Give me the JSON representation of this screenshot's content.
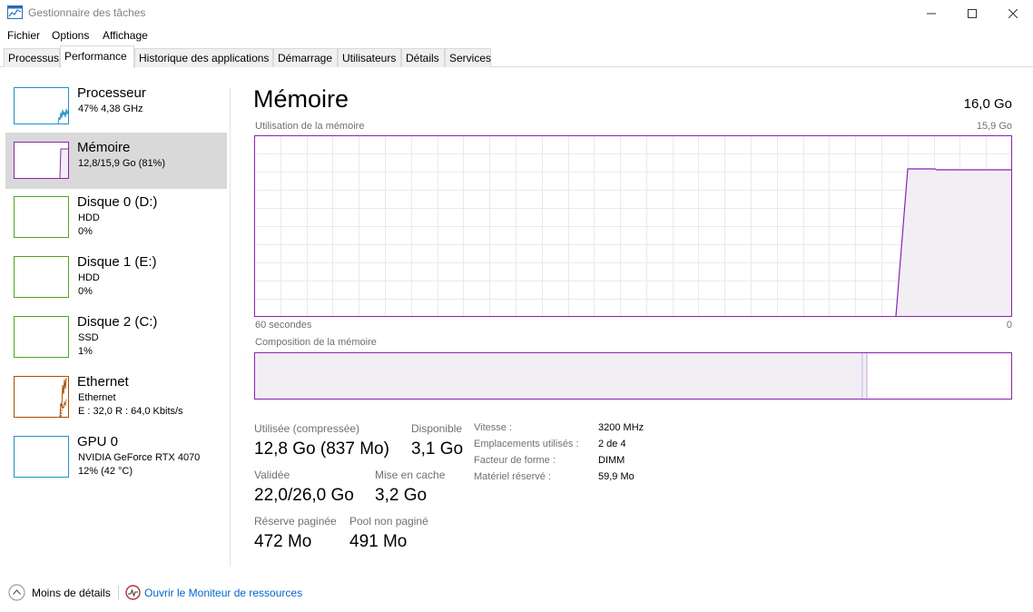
{
  "window": {
    "title": "Gestionnaire des tâches",
    "icon": "task-manager-icon"
  },
  "menu": [
    "Fichier",
    "Options",
    "Affichage"
  ],
  "tabs": [
    {
      "label": "Processus",
      "active": false
    },
    {
      "label": "Performance",
      "active": true
    },
    {
      "label": "Historique des applications",
      "active": false
    },
    {
      "label": "Démarrage",
      "active": false
    },
    {
      "label": "Utilisateurs",
      "active": false
    },
    {
      "label": "Détails",
      "active": false
    },
    {
      "label": "Services",
      "active": false
    }
  ],
  "sidebar": [
    {
      "title": "Processeur",
      "line1": "47%  4,38 GHz",
      "line2": "",
      "color": "#1e90c8",
      "selected": false
    },
    {
      "title": "Mémoire",
      "line1": "12,8/15,9 Go (81%)",
      "line2": "",
      "color": "#8b22b0",
      "selected": true
    },
    {
      "title": "Disque 0 (D:)",
      "line1": "HDD",
      "line2": "0%",
      "color": "#4ca81c",
      "selected": false
    },
    {
      "title": "Disque 1 (E:)",
      "line1": "HDD",
      "line2": "0%",
      "color": "#4ca81c",
      "selected": false
    },
    {
      "title": "Disque 2 (C:)",
      "line1": "SSD",
      "line2": "1%",
      "color": "#4ca81c",
      "selected": false
    },
    {
      "title": "Ethernet",
      "line1": "Ethernet",
      "line2": "E : 32,0  R : 64,0 Kbits/s",
      "color": "#a74f00",
      "selected": false
    },
    {
      "title": "GPU 0",
      "line1": "NVIDIA GeForce RTX 4070",
      "line2": "12%  (42 °C)",
      "color": "#1e90c8",
      "selected": false
    }
  ],
  "main": {
    "title": "Mémoire",
    "total": "16,0 Go",
    "usage_label": "Utilisation de la mémoire",
    "usage_max": "15,9 Go",
    "time_left": "60 secondes",
    "time_right": "0",
    "composition_label": "Composition de la mémoire",
    "usage_fraction_recent": 0.81,
    "composition": {
      "in_use_fraction": 0.805,
      "modified_fraction": 0.004
    },
    "accent": "#8b22b0",
    "fill": "#f1eef4"
  },
  "stats": {
    "used_label": "Utilisée (compressée)",
    "used_value": "12,8 Go (837 Mo)",
    "available_label": "Disponible",
    "available_value": "3,1 Go",
    "committed_label": "Validée",
    "committed_value": "22,0/26,0 Go",
    "cached_label": "Mise en cache",
    "cached_value": "3,2 Go",
    "paged_label": "Réserve paginée",
    "paged_value": "472 Mo",
    "nonpaged_label": "Pool non paginé",
    "nonpaged_value": "491 Mo"
  },
  "properties": [
    {
      "label": "Vitesse :",
      "value": "3200 MHz"
    },
    {
      "label": "Emplacements utilisés :",
      "value": "2 de 4"
    },
    {
      "label": "Facteur de forme :",
      "value": "DIMM"
    },
    {
      "label": "Matériel réservé :",
      "value": "59,9 Mo"
    }
  ],
  "footer": {
    "less_details": "Moins de détails",
    "resource_monitor": "Ouvrir le Moniteur de ressources"
  }
}
